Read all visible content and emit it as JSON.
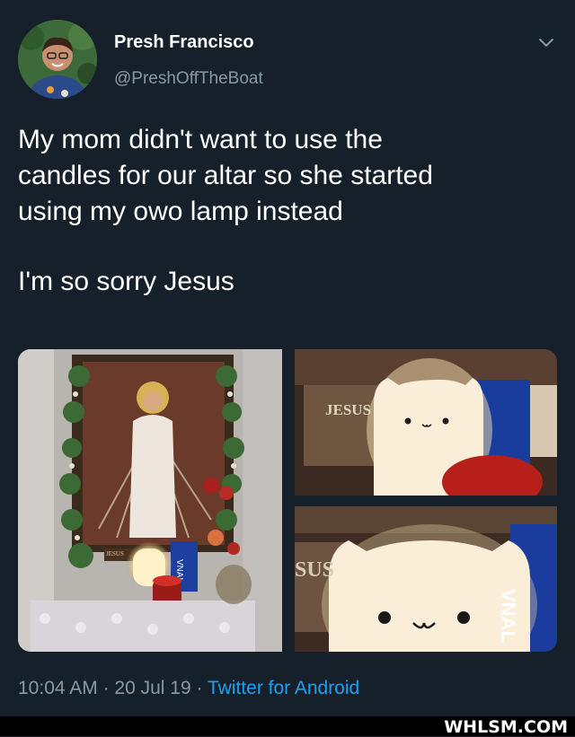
{
  "tweet": {
    "display_name": "Presh Francisco",
    "handle": "@PreshOffTheBoat",
    "text_line_1": "My mom didn't want to use the",
    "text_line_2": "candles for our altar so she started",
    "text_line_3": "using my owo lamp instead",
    "text_line_4": "I'm so sorry Jesus",
    "time": "10:04 AM",
    "date": "20 Jul 19",
    "separator": "·",
    "source": "Twitter for Android"
  },
  "media": {
    "altar_label": "JESUS",
    "closeup_top_label": "JESUS",
    "closeup_bottom_label": "SUS",
    "box_text": "VNAL"
  },
  "icons": {
    "options": "chevron-down-icon"
  },
  "watermark": {
    "text": "WHLSM.COM"
  },
  "colors": {
    "background": "#15202b",
    "secondary_text": "#8899a6",
    "link": "#1da1f2"
  }
}
